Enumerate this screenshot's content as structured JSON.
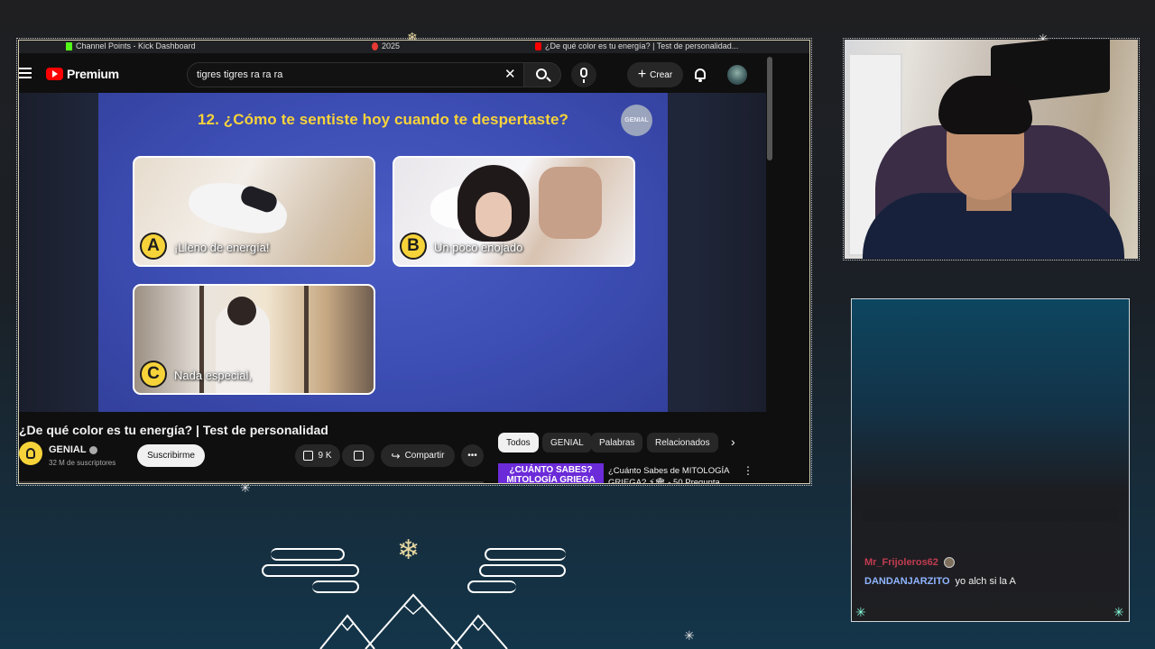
{
  "browser": {
    "tabs": [
      {
        "title": "Channel Points - Kick Dashboard",
        "icon": "kick-icon"
      },
      {
        "title": "2025",
        "icon": "record-icon"
      },
      {
        "title": "¿De qué color es tu energía? | Test de personalidad...",
        "icon": "youtube-icon"
      }
    ]
  },
  "youtube": {
    "logo": "Premium",
    "search": {
      "value": "tigres tigres ra ra ra",
      "placeholder": "Buscar"
    },
    "create_label": "Crear",
    "video": {
      "question": "12. ¿Cómo te sentiste hoy cuando te despertaste?",
      "badge": "GENIAL",
      "options": [
        {
          "letter": "A",
          "label": "¡Lleno de energía!"
        },
        {
          "letter": "B",
          "label": "Un poco enojado"
        },
        {
          "letter": "C",
          "label": "Nada especial,"
        }
      ]
    },
    "title": "¿De qué color es tu energía? | Test de personalidad",
    "channel": {
      "name": "GENIAL",
      "subscribers": "32 M de suscriptores"
    },
    "subscribe_label": "Suscribirme",
    "likes": "9 K",
    "share_label": "Compartir",
    "chips": [
      "Todos",
      "GENIAL",
      "Palabras",
      "Relacionados"
    ],
    "recommendation": {
      "thumb_text": "¿CUÁNTO SABES?\nMITOLOGÍA GRIEGA",
      "title": "¿Cuánto Sabes de MITOLOGÍA GRIEGA? ⚡🏛 - 50 Pregunta"
    }
  },
  "chat": {
    "messages": [
      {
        "user": "Mr_Frijoleros62",
        "text": ""
      },
      {
        "user": "DANDANJARZITO",
        "text": "yo alch si la A"
      }
    ]
  },
  "colors": {
    "accent_yellow": "#f7d33a",
    "slide_blue": "#3c4db3",
    "youtube_red": "#ff0000",
    "chat_user_1": "#d43f56",
    "chat_user_2": "#8fb4ff"
  }
}
